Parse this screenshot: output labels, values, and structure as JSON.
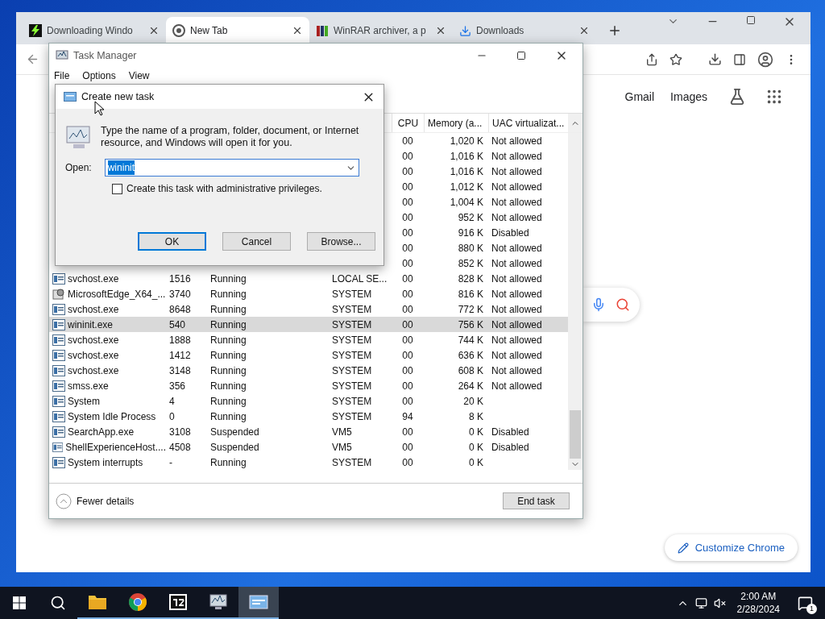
{
  "browser": {
    "tabs": [
      {
        "title": "Downloading Windo",
        "kind": "bolt",
        "selected": false
      },
      {
        "title": "New Tab",
        "kind": "chrome",
        "selected": true
      },
      {
        "title": "WinRAR archiver, a p",
        "kind": "books",
        "selected": false
      },
      {
        "title": "Downloads",
        "kind": "download",
        "selected": false
      }
    ],
    "page": {
      "links": [
        "Gmail",
        "Images"
      ],
      "customize_button": "Customize Chrome"
    }
  },
  "task_manager": {
    "title": "Task Manager",
    "menu": [
      "File",
      "Options",
      "View"
    ],
    "columns": [
      "CPU",
      "Memory (a...",
      "UAC virtualizat..."
    ],
    "rows": [
      {
        "cpu": "00",
        "memory": "1,020 K",
        "uac": "Not allowed",
        "selected": false
      },
      {
        "cpu": "00",
        "memory": "1,016 K",
        "uac": "Not allowed",
        "selected": false
      },
      {
        "cpu": "00",
        "memory": "1,016 K",
        "uac": "Not allowed",
        "selected": false
      },
      {
        "cpu": "00",
        "memory": "1,012 K",
        "uac": "Not allowed",
        "selected": false
      },
      {
        "cpu": "00",
        "memory": "1,004 K",
        "uac": "Not allowed",
        "selected": false
      },
      {
        "cpu": "00",
        "memory": "952 K",
        "uac": "Not allowed",
        "selected": false
      },
      {
        "cpu": "00",
        "memory": "916 K",
        "uac": "Disabled",
        "selected": false
      },
      {
        "cpu": "00",
        "memory": "880 K",
        "uac": "Not allowed",
        "selected": false
      },
      {
        "cpu": "00",
        "memory": "852 K",
        "uac": "Not allowed",
        "selected": false
      },
      {
        "name": "svchost.exe",
        "kind": "window",
        "pid": "1516",
        "status": "Running",
        "user": "LOCAL SE...",
        "cpu": "00",
        "memory": "828 K",
        "uac": "Not allowed",
        "selected": false
      },
      {
        "name": "MicrosoftEdge_X64_...",
        "kind": "installer",
        "pid": "3740",
        "status": "Running",
        "user": "SYSTEM",
        "cpu": "00",
        "memory": "816 K",
        "uac": "Not allowed",
        "selected": false
      },
      {
        "name": "svchost.exe",
        "kind": "window",
        "pid": "8648",
        "status": "Running",
        "user": "SYSTEM",
        "cpu": "00",
        "memory": "772 K",
        "uac": "Not allowed",
        "selected": false
      },
      {
        "name": "wininit.exe",
        "kind": "window",
        "pid": "540",
        "status": "Running",
        "user": "SYSTEM",
        "cpu": "00",
        "memory": "756 K",
        "uac": "Not allowed",
        "selected": true
      },
      {
        "name": "svchost.exe",
        "kind": "window",
        "pid": "1888",
        "status": "Running",
        "user": "SYSTEM",
        "cpu": "00",
        "memory": "744 K",
        "uac": "Not allowed",
        "selected": false
      },
      {
        "name": "svchost.exe",
        "kind": "window",
        "pid": "1412",
        "status": "Running",
        "user": "SYSTEM",
        "cpu": "00",
        "memory": "636 K",
        "uac": "Not allowed",
        "selected": false
      },
      {
        "name": "svchost.exe",
        "kind": "window",
        "pid": "3148",
        "status": "Running",
        "user": "SYSTEM",
        "cpu": "00",
        "memory": "608 K",
        "uac": "Not allowed",
        "selected": false
      },
      {
        "name": "smss.exe",
        "kind": "window",
        "pid": "356",
        "status": "Running",
        "user": "SYSTEM",
        "cpu": "00",
        "memory": "264 K",
        "uac": "Not allowed",
        "selected": false
      },
      {
        "name": "System",
        "kind": "window",
        "pid": "4",
        "status": "Running",
        "user": "SYSTEM",
        "cpu": "00",
        "memory": "20 K",
        "selected": false
      },
      {
        "name": "System Idle Process",
        "kind": "window",
        "pid": "0",
        "status": "Running",
        "user": "SYSTEM",
        "cpu": "94",
        "memory": "8 K",
        "selected": false
      },
      {
        "name": "SearchApp.exe",
        "kind": "window",
        "pid": "3108",
        "status": "Suspended",
        "user": "VM5",
        "cpu": "00",
        "memory": "0 K",
        "uac": "Disabled",
        "selected": false
      },
      {
        "name": "ShellExperienceHost....",
        "kind": "window",
        "pid": "4508",
        "status": "Suspended",
        "user": "VM5",
        "cpu": "00",
        "memory": "0 K",
        "uac": "Disabled",
        "selected": false
      },
      {
        "name": "System interrupts",
        "kind": "window",
        "pid": "-",
        "status": "Running",
        "user": "SYSTEM",
        "cpu": "00",
        "memory": "0 K",
        "selected": false
      }
    ],
    "footer": {
      "toggle": "Fewer details",
      "end_task": "End task"
    }
  },
  "dialog": {
    "title": "Create new task",
    "message": "Type the name of a program, folder, document, or Internet resource, and Windows will open it for you.",
    "open_label": "Open:",
    "value": "wininit",
    "value_highlighted": true,
    "checkbox": {
      "label": "Create this task with administrative privileges.",
      "checked": false
    },
    "buttons": [
      {
        "label": "OK",
        "default": true
      },
      {
        "label": "Cancel",
        "default": false
      },
      {
        "label": "Browse...",
        "default": false
      }
    ]
  },
  "taskbar": {
    "apps": [
      {
        "kind": "explorer",
        "active": false,
        "open": true
      },
      {
        "kind": "chrome",
        "active": false,
        "open": true
      },
      {
        "kind": "sevenzip",
        "active": false,
        "open": true
      },
      {
        "kind": "taskmgr",
        "active": false,
        "open": true
      },
      {
        "kind": "run",
        "active": true,
        "open": true
      }
    ],
    "time": "2:00 AM",
    "date": "2/28/2024",
    "notifications": "1"
  }
}
